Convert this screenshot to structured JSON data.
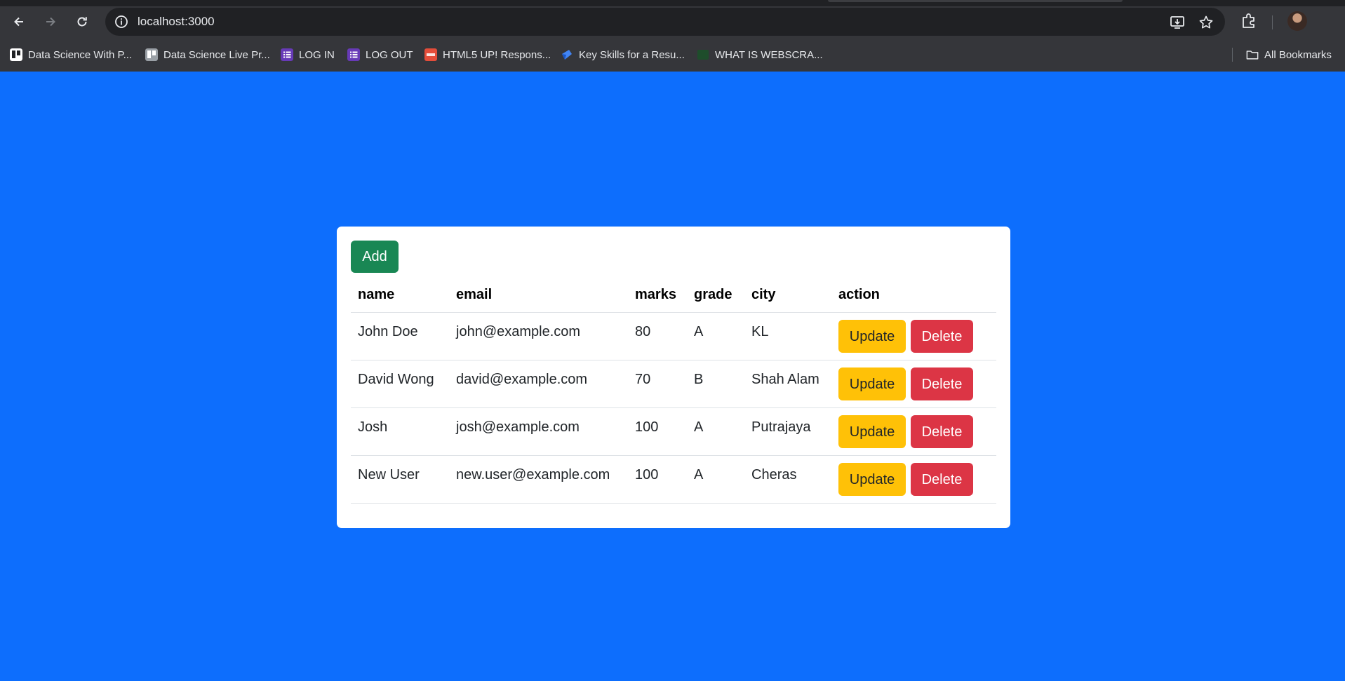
{
  "browser": {
    "url": "localhost:3000",
    "bookmarks": [
      {
        "label": "Data Science With P...",
        "icon": "trello-icon",
        "color": "#ffffff"
      },
      {
        "label": "Data Science Live Pr...",
        "icon": "trello-icon",
        "color": "#9aa0a6"
      },
      {
        "label": "LOG IN",
        "icon": "forms-icon",
        "color": "#673ab7"
      },
      {
        "label": "LOG OUT",
        "icon": "forms-icon",
        "color": "#673ab7"
      },
      {
        "label": "HTML5 UP! Respons...",
        "icon": "html5up-icon",
        "color": "#e44d3a"
      },
      {
        "label": "Key Skills for a Resu...",
        "icon": "bookmark-site-icon",
        "color": "#4285f4"
      },
      {
        "label": "WHAT IS WEBSCRA...",
        "icon": "bookmark-site-icon",
        "color": "#1e4d2b"
      }
    ],
    "all_bookmarks_label": "All Bookmarks"
  },
  "page": {
    "add_label": "Add",
    "columns": [
      "name",
      "email",
      "marks",
      "grade",
      "city",
      "action"
    ],
    "rows": [
      {
        "name": "John Doe",
        "email": "john@example.com",
        "marks": "80",
        "grade": "A",
        "city": "KL"
      },
      {
        "name": "David Wong",
        "email": "david@example.com",
        "marks": "70",
        "grade": "B",
        "city": "Shah Alam"
      },
      {
        "name": "Josh",
        "email": "josh@example.com",
        "marks": "100",
        "grade": "A",
        "city": "Putrajaya"
      },
      {
        "name": "New User",
        "email": "new.user@example.com",
        "marks": "100",
        "grade": "A",
        "city": "Cheras"
      }
    ],
    "update_label": "Update",
    "delete_label": "Delete"
  },
  "colors": {
    "background": "#0d6efd",
    "add": "#198754",
    "update": "#ffc107",
    "delete": "#dc3545"
  }
}
